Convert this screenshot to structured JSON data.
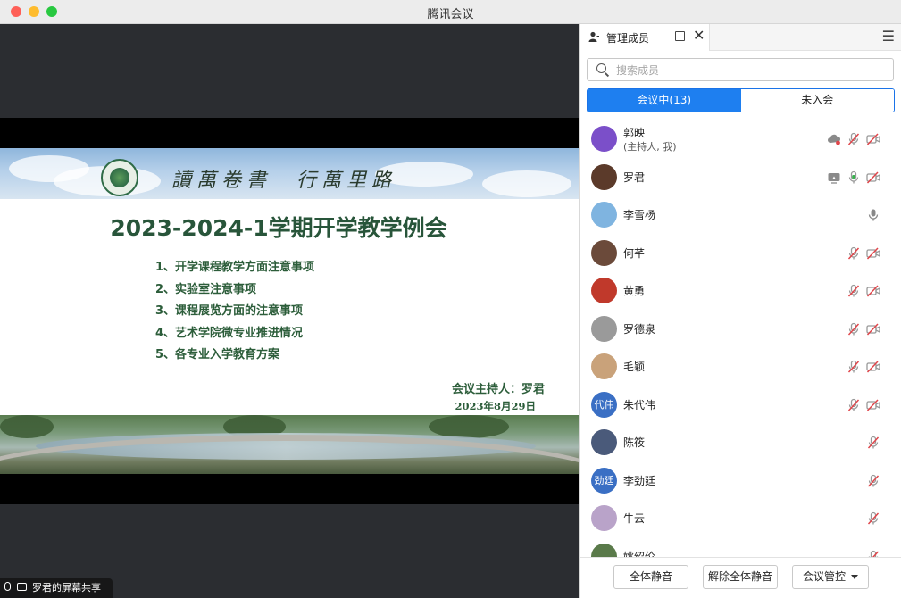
{
  "window": {
    "title": "腾讯会议"
  },
  "slide": {
    "motto": "讀萬卷書　行萬里路",
    "title": "2023-2024-1学期开学教学例会",
    "agenda": [
      "1、开学课程教学方面注意事项",
      "2、实验室注意事项",
      "3、课程展览方面的注意事项",
      "4、艺术学院微专业推进情况",
      "5、各专业入学教育方案"
    ],
    "host": "会议主持人：罗君",
    "date": "2023年8月29日"
  },
  "share_tag": {
    "label": "罗君的屏幕共享"
  },
  "panel": {
    "tab_title": "管理成员",
    "search_placeholder": "搜索成员",
    "segments": {
      "in_meeting": "会议中(13)",
      "not_joined": "未入会"
    },
    "members": [
      {
        "name": "郭映",
        "sub": "(主持人, 我)",
        "avatar_color": "#7b4fc9",
        "icons": [
          "cloud-record-icon",
          "mic-muted-icon",
          "camera-off-icon"
        ]
      },
      {
        "name": "罗君",
        "sub": "",
        "avatar_color": "#5b3a2a",
        "icons": [
          "screen-share-icon",
          "mic-on-icon",
          "camera-off-icon"
        ]
      },
      {
        "name": "李雪杨",
        "sub": "",
        "avatar_color": "#7fb4e0",
        "icons": [
          "mic-icon"
        ]
      },
      {
        "name": "何芊",
        "sub": "",
        "avatar_color": "#6b4a3a",
        "icons": [
          "mic-muted-icon",
          "camera-off-icon"
        ]
      },
      {
        "name": "黄勇",
        "sub": "",
        "avatar_color": "#c0392b",
        "icons": [
          "mic-muted-icon",
          "camera-off-icon"
        ]
      },
      {
        "name": "罗德泉",
        "sub": "",
        "avatar_color": "#9a9a9a",
        "icons": [
          "mic-muted-icon",
          "camera-off-icon"
        ]
      },
      {
        "name": "毛颖",
        "sub": "",
        "avatar_color": "#c9a27a",
        "icons": [
          "mic-muted-icon",
          "camera-off-icon"
        ]
      },
      {
        "name": "朱代伟",
        "sub": "",
        "avatar_color": "#3a6fc4",
        "avatar_text": "代伟",
        "icons": [
          "mic-muted-icon",
          "camera-off-icon"
        ]
      },
      {
        "name": "陈筱",
        "sub": "",
        "avatar_color": "#4a5a7a",
        "icons": [
          "mic-muted-icon"
        ]
      },
      {
        "name": "李劲廷",
        "sub": "",
        "avatar_color": "#3a6fc4",
        "avatar_text": "劲廷",
        "icons": [
          "mic-muted-icon"
        ]
      },
      {
        "name": "牛云",
        "sub": "",
        "avatar_color": "#b9a3c9",
        "icons": [
          "mic-muted-icon"
        ]
      },
      {
        "name": "姚绍伦",
        "sub": "",
        "avatar_color": "#5a7a4a",
        "icons": [
          "mic-muted-icon"
        ]
      }
    ],
    "footer": {
      "mute_all": "全体静音",
      "unmute_all": "解除全体静音",
      "control": "会议管控"
    }
  },
  "colors": {
    "accent": "#1e7ff0",
    "muted_red": "#e0454a",
    "slide_green": "#28553a"
  }
}
